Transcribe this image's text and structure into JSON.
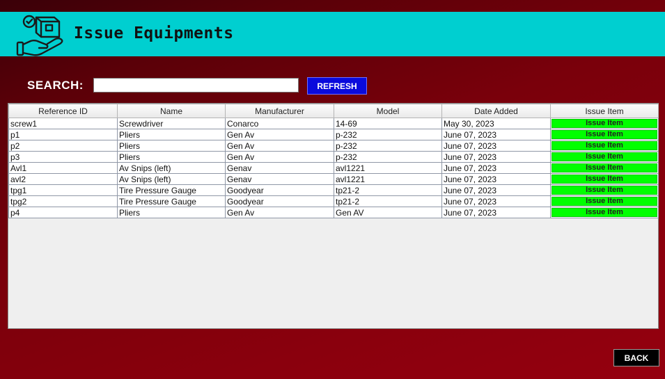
{
  "header": {
    "title": "Issue Equipments",
    "logo_icon": "hand-holding-box-icon"
  },
  "search": {
    "label": "SEARCH:",
    "value": "",
    "placeholder": "",
    "refresh_label": "REFRESH"
  },
  "table": {
    "columns": [
      "Reference ID",
      "Name",
      "Manufacturer",
      "Model",
      "Date Added",
      "Issue Item"
    ],
    "rows": [
      {
        "ref": "screw1",
        "name": "Screwdriver",
        "manufacturer": "Conarco",
        "model": "14-69",
        "date": "May 30, 2023",
        "action": "Issue Item"
      },
      {
        "ref": "p1",
        "name": "Pliers",
        "manufacturer": "Gen Av",
        "model": "p-232",
        "date": "June 07, 2023",
        "action": "Issue Item"
      },
      {
        "ref": "p2",
        "name": "Pliers",
        "manufacturer": "Gen Av",
        "model": "p-232",
        "date": "June 07, 2023",
        "action": "Issue Item"
      },
      {
        "ref": "p3",
        "name": "Pliers",
        "manufacturer": "Gen Av",
        "model": "p-232",
        "date": "June 07, 2023",
        "action": "Issue Item"
      },
      {
        "ref": "Avl1",
        "name": "Av Snips (left)",
        "manufacturer": "Genav",
        "model": "avl1221",
        "date": "June 07, 2023",
        "action": "Issue Item"
      },
      {
        "ref": "avl2",
        "name": "Av Snips (left)",
        "manufacturer": "Genav",
        "model": "avl1221",
        "date": "June 07, 2023",
        "action": "Issue Item"
      },
      {
        "ref": "tpg1",
        "name": "Tire Pressure Gauge",
        "manufacturer": "Goodyear",
        "model": "tp21-2",
        "date": "June 07, 2023",
        "action": "Issue Item"
      },
      {
        "ref": "tpg2",
        "name": "Tire Pressure Gauge",
        "manufacturer": "Goodyear",
        "model": "tp21-2",
        "date": "June 07, 2023",
        "action": "Issue Item"
      },
      {
        "ref": "p4",
        "name": "Pliers",
        "manufacturer": "Gen Av",
        "model": "Gen AV",
        "date": "June 07, 2023",
        "action": "Issue Item"
      }
    ]
  },
  "footer": {
    "back_label": "BACK"
  },
  "colors": {
    "header_bg": "#00cfd0",
    "background": "#8a000d",
    "refresh_bg": "#0a0adc",
    "issue_bg": "#00ff00",
    "back_bg": "#000000"
  }
}
